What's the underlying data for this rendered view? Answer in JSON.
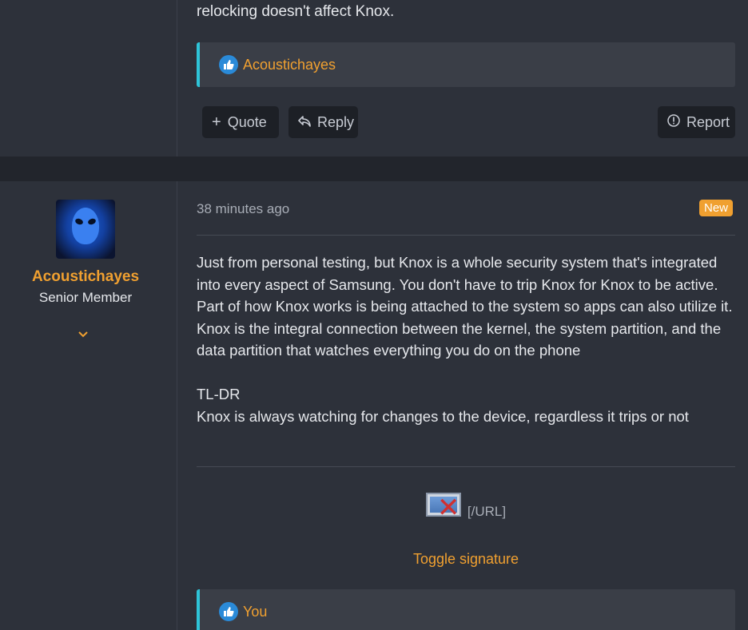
{
  "post_top": {
    "text_tail": "relocking doesn't affect Knox.",
    "reaction_user": "Acoustichayes",
    "buttons": {
      "quote_label": "Quote",
      "reply_label": "Reply",
      "report_label": "Report"
    }
  },
  "post_bottom": {
    "user": {
      "name": "Acoustichayes",
      "title": "Senior Member",
      "expand_icon": "chevron-down-icon"
    },
    "timestamp": "38 minutes ago",
    "badge": "New",
    "body": {
      "paragraph1": "Just from personal testing, but Knox is a whole security system that's integrated into every aspect of Samsung. You don't have to trip Knox for Knox to be active. Part of how Knox works is being attached to the system so apps can also utilize it. Knox is the integral connection between the kernel, the system partition, and the data partition that watches everything you do on the phone",
      "tldr": "TL-DR",
      "tldr_text": "Knox is always watching for changes to the device, regardless it trips or not"
    },
    "signature": {
      "url_text": "[/URL]",
      "toggle_label": "Toggle signature"
    },
    "reaction_user": "You"
  },
  "colors": {
    "accent": "#f0a030",
    "reaction_border": "#2ec4d8",
    "like_icon": "#2a8ad8",
    "background": "#2d313a",
    "separator": "#22252c"
  }
}
